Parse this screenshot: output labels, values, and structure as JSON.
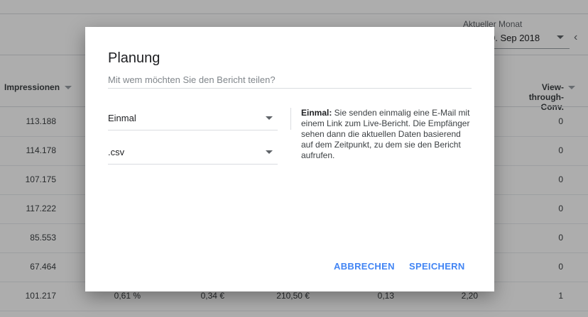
{
  "report": {
    "month_label": "Aktueller Monat",
    "month_value": "0. Sep 2018",
    "columns": {
      "impressions": "Impressionen",
      "view_through_line1": "View-through-",
      "view_through_line2": "Conv."
    },
    "rows": [
      {
        "impressions": "113.188",
        "ctr": "",
        "cpc": "",
        "cost": "",
        "conv": "",
        "cpa": "",
        "vtc": "0"
      },
      {
        "impressions": "114.178",
        "ctr": "",
        "cpc": "",
        "cost": "",
        "conv": "",
        "cpa": "",
        "vtc": "0"
      },
      {
        "impressions": "107.175",
        "ctr": "",
        "cpc": "",
        "cost": "",
        "conv": "",
        "cpa": "",
        "vtc": "0"
      },
      {
        "impressions": "117.222",
        "ctr": "",
        "cpc": "",
        "cost": "",
        "conv": "",
        "cpa": "",
        "vtc": "0"
      },
      {
        "impressions": "85.553",
        "ctr": "",
        "cpc": "",
        "cost": "",
        "conv": "",
        "cpa": "",
        "vtc": "0"
      },
      {
        "impressions": "67.464",
        "ctr": "",
        "cpc": "",
        "cost": "",
        "conv": "",
        "cpa": "",
        "vtc": "0"
      },
      {
        "impressions": "101.217",
        "ctr": "0,61 %",
        "cpc": "0,34 €",
        "cost": "210,50 €",
        "conv": "0,13",
        "cpa": "2,20",
        "vtc": "1"
      }
    ]
  },
  "dialog": {
    "title": "Planung",
    "share_placeholder": "Mit wem möchten Sie den Bericht teilen?",
    "frequency": "Einmal",
    "format": ".csv",
    "info_term": "Einmal:",
    "info_text": " Sie senden einmalig eine E-Mail mit einem Link zum Live-Bericht. Die Empfänger sehen dann die aktuellen Daten basierend auf dem Zeitpunkt, zu dem sie den Bericht aufrufen.",
    "cancel_label": "ABBRECHEN",
    "save_label": "SPEICHERN"
  },
  "colors": {
    "accent": "#4285f4",
    "scrim": "rgba(0,0,0,0.32)"
  }
}
